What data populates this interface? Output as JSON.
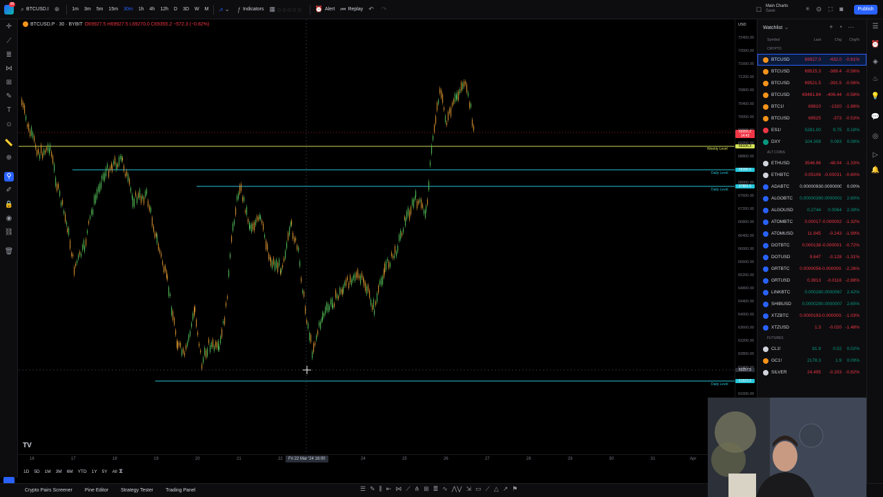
{
  "topbar": {
    "logo_badge": "99",
    "symbol": "BTCUSD.I",
    "timeframes": [
      "1m",
      "3m",
      "5m",
      "15m",
      "30m",
      "1h",
      "4h",
      "12h",
      "D",
      "3D",
      "W",
      "M",
      "4H",
      "3M",
      "12H"
    ],
    "active_timeframe": "30m",
    "indicators_label": "Indicators",
    "alert_label": "Alert",
    "replay_label": "Replay",
    "layout_name": "Main Charts",
    "layout_sub": "Save",
    "publish_label": "Publish"
  },
  "chart": {
    "legend_symbol": "BTCUSD.P · 30 · BYBIT",
    "legend_ohlc": "O69927.5 H69927.5 L69270.0 C69355.2 −572.3 (−0.82%)",
    "currency": "USD",
    "price_labels": [
      "72400.00",
      "72000.00",
      "71600.00",
      "71200.00",
      "70800.00",
      "70400.00",
      "70000.00",
      "69600.00",
      "69200.00",
      "68800.00",
      "68400.00",
      "68000.00",
      "67600.00",
      "67200.00",
      "66800.00",
      "66400.00",
      "66000.00",
      "65600.00",
      "65200.00",
      "64800.00",
      "64400.00",
      "64000.00",
      "63600.00",
      "63200.00",
      "62800.00",
      "62400.00",
      "62000.00",
      "61600.00"
    ],
    "current_price_badge": "69355.2",
    "current_time_badge": "14:43",
    "weekly_level_badge": "69106.3",
    "daily_level_1_badge": "68386.5",
    "daily_level_2_badge": "67881.5",
    "crosshair_badge": "62257.5",
    "daily_level_3_badge": "61923.0",
    "level_labels": {
      "weekly": "Weekly Level",
      "daily": "Daily Level"
    },
    "time_labels": [
      "16",
      "17",
      "18",
      "19",
      "20",
      "21",
      "22",
      "24",
      "25",
      "26",
      "27",
      "28",
      "29",
      "30",
      "31",
      "Apr"
    ],
    "crosshair_time": "Fri 22 Mar '24  16:00",
    "watermark": "TV"
  },
  "ranges": [
    "1D",
    "5D",
    "1M",
    "3M",
    "6M",
    "YTD",
    "1Y",
    "5Y",
    "All"
  ],
  "bottom_tabs": [
    "Crypto Pairs Screener",
    "Pine Editor",
    "Strategy Tester",
    "Trading Panel"
  ],
  "watchlist": {
    "title": "Watchlist",
    "columns": {
      "symbol": "Symbol",
      "last": "Last",
      "chg": "Chg",
      "chgp": "Chg%"
    },
    "sections": [
      {
        "name": "CRYPTO",
        "rows": [
          {
            "symbol": "BTCUSD",
            "last": "69927.0",
            "chg": "-432.0",
            "chgp": "-0.61%",
            "dir": "dn",
            "color": "#f7931a",
            "selected": true
          },
          {
            "symbol": "BTCUSD",
            "last": "69515.3",
            "chg": "-389.4",
            "chgp": "-0.56%",
            "dir": "dn",
            "color": "#f7931a",
            "selected": false
          },
          {
            "symbol": "BTCUSD",
            "last": "69521.5",
            "chg": "-391.5",
            "chgp": "-0.56%",
            "dir": "dn",
            "color": "#f7931a",
            "selected": false
          },
          {
            "symbol": "BTCUSD",
            "last": "69481.84",
            "chg": "-406.44",
            "chgp": "-0.58%",
            "dir": "dn",
            "color": "#f7931a",
            "selected": false
          },
          {
            "symbol": "BTC1!",
            "last": "69810",
            "chg": "-1320",
            "chgp": "-1.86%",
            "dir": "dn",
            "color": "#f7931a",
            "selected": false
          },
          {
            "symbol": "BTCUSD",
            "last": "69525",
            "chg": "-373",
            "chgp": "-0.53%",
            "dir": "dn",
            "color": "#f7931a",
            "selected": false
          },
          {
            "symbol": "ES1!",
            "last": "5281.00",
            "chg": "9.75",
            "chgp": "0.18%",
            "dir": "up",
            "color": "#f23645",
            "selected": false
          },
          {
            "symbol": "DXY",
            "last": "104.308",
            "chg": "0.083",
            "chgp": "0.08%",
            "dir": "up",
            "color": "#089981",
            "selected": false
          }
        ]
      },
      {
        "name": "ALT COINS",
        "rows": [
          {
            "symbol": "ETHUSD",
            "last": "3546.96",
            "chg": "-48.04",
            "chgp": "-1.33%",
            "dir": "dn",
            "color": "#d1d4dc"
          },
          {
            "symbol": "ETHBTC",
            "last": "0.05106",
            "chg": "-0.00031",
            "chgp": "-0.60%",
            "dir": "dn",
            "color": "#d1d4dc"
          },
          {
            "symbol": "ADABTC",
            "last": "0.0000093",
            "chg": "0.0000000",
            "chgp": "0.00%",
            "dir": "neu",
            "color": "#2962ff"
          },
          {
            "symbol": "ALGOBTC",
            "last": "0.0000039",
            "chg": "0.0000001",
            "chgp": "2.60%",
            "dir": "up",
            "color": "#2962ff"
          },
          {
            "symbol": "ALGOUSD",
            "last": "0.2744",
            "chg": "0.0064",
            "chgp": "2.39%",
            "dir": "up",
            "color": "#2962ff"
          },
          {
            "symbol": "ATOMBTC",
            "last": "0.00017",
            "chg": "-0.000002",
            "chgp": "-1.32%",
            "dir": "dn",
            "color": "#2962ff"
          },
          {
            "symbol": "ATOMUSD",
            "last": "11.945",
            "chg": "-0.243",
            "chgp": "-1.99%",
            "dir": "dn",
            "color": "#2962ff"
          },
          {
            "symbol": "DOTBTC",
            "last": "0.000138",
            "chg": "-0.000001",
            "chgp": "-0.72%",
            "dir": "dn",
            "color": "#2962ff"
          },
          {
            "symbol": "DOTUSD",
            "last": "9.647",
            "chg": "-0.128",
            "chgp": "-1.31%",
            "dir": "dn",
            "color": "#2962ff"
          },
          {
            "symbol": "GRTBTC",
            "last": "0.0000056",
            "chg": "-0.0000001",
            "chgp": "-2.26%",
            "dir": "dn",
            "color": "#2962ff"
          },
          {
            "symbol": "GRTUSD",
            "last": "0.3913",
            "chg": "-0.0116",
            "chgp": "-2.88%",
            "dir": "dn",
            "color": "#2962ff"
          },
          {
            "symbol": "LINKBTC",
            "last": "0.00028",
            "chg": "0.0000067",
            "chgp": "2.42%",
            "dir": "up",
            "color": "#2962ff"
          },
          {
            "symbol": "SHIBUSD",
            "last": "0.000029",
            "chg": "0.0000007",
            "chgp": "2.65%",
            "dir": "up",
            "color": "#2962ff"
          },
          {
            "symbol": "XTZBTC",
            "last": "0.0000193",
            "chg": "-0.0000002",
            "chgp": "-1.03%",
            "dir": "dn",
            "color": "#2962ff"
          },
          {
            "symbol": "XTZUSD",
            "last": "1.3",
            "chg": "-0.020",
            "chgp": "-1.48%",
            "dir": "dn",
            "color": "#2962ff"
          }
        ]
      },
      {
        "name": "FUTURES",
        "rows": [
          {
            "symbol": "CL1!",
            "last": "81.9",
            "chg": "0.02",
            "chgp": "0.02%",
            "dir": "up",
            "color": "#d1d4dc"
          },
          {
            "symbol": "GC1!",
            "last": "2178.3",
            "chg": "1.9",
            "chgp": "0.09%",
            "dir": "up",
            "color": "#f7931a"
          },
          {
            "symbol": "SILVER",
            "last": "24.495",
            "chg": "-0.203",
            "chgp": "-0.82%",
            "dir": "dn",
            "color": "#d1d4dc"
          }
        ]
      }
    ]
  }
}
